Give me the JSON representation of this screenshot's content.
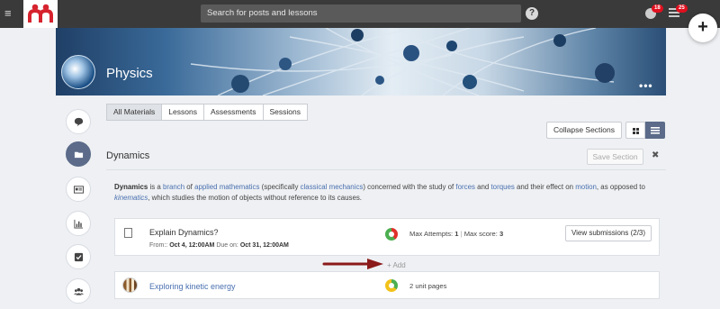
{
  "topbar": {
    "search_placeholder": "Search for posts and lessons",
    "notifications_count": "18",
    "messages_count": "25",
    "help_label": "?",
    "menu_icon": "hamburger-icon"
  },
  "course": {
    "title": "Physics",
    "more_label": "•••"
  },
  "left_rail": [
    {
      "icon": "chat-icon",
      "active": false
    },
    {
      "icon": "folder-icon",
      "active": true
    },
    {
      "icon": "card-icon",
      "active": false
    },
    {
      "icon": "bar-chart-icon",
      "active": false
    },
    {
      "icon": "checkbox-icon",
      "active": false
    },
    {
      "icon": "people-icon",
      "active": false
    }
  ],
  "tabs": [
    {
      "label": "All Materials",
      "active": true
    },
    {
      "label": "Lessons",
      "active": false
    },
    {
      "label": "Assessments",
      "active": false
    },
    {
      "label": "Sessions",
      "active": false
    }
  ],
  "toolbar": {
    "collapse_label": "Collapse Sections"
  },
  "section": {
    "title": "Dynamics",
    "save_label": "Save Section",
    "close_label": "✖",
    "description": {
      "term": "Dynamics",
      "t1": " is a ",
      "l1": "branch",
      "t2": " of ",
      "l2": "applied mathematics",
      "t3": " (specifically ",
      "l3": "classical mechanics",
      "t4": ") concerned with the study of ",
      "l4": "forces",
      "t5": " and ",
      "l5": "torques",
      "t6": " and their effect on ",
      "l6": "motion",
      "t7": ", as opposed to ",
      "l7": "kinematics",
      "t8": ", which studies the motion of objects without reference to its causes."
    }
  },
  "items": {
    "assignment": {
      "title": "Explain Dynamics?",
      "from_label": "From::",
      "from_date": "Oct 4, 12:00AM",
      "due_label": "Due on:",
      "due_date": "Oct 31, 12:00AM",
      "max_attempts_label": "Max Attempts:",
      "max_attempts": "1",
      "sep": "|",
      "max_score_label": "Max score:",
      "max_score": "3",
      "view_submissions": "View submissions (2/3)"
    },
    "add_label": "+ Add",
    "lesson": {
      "title": "Exploring kinetic energy",
      "unit_pages": "2 unit pages"
    }
  },
  "colors": {
    "accent": "#5b6b89",
    "link": "#4a70b0",
    "badge": "#e0101f",
    "arrow": "#8b1a1a"
  }
}
